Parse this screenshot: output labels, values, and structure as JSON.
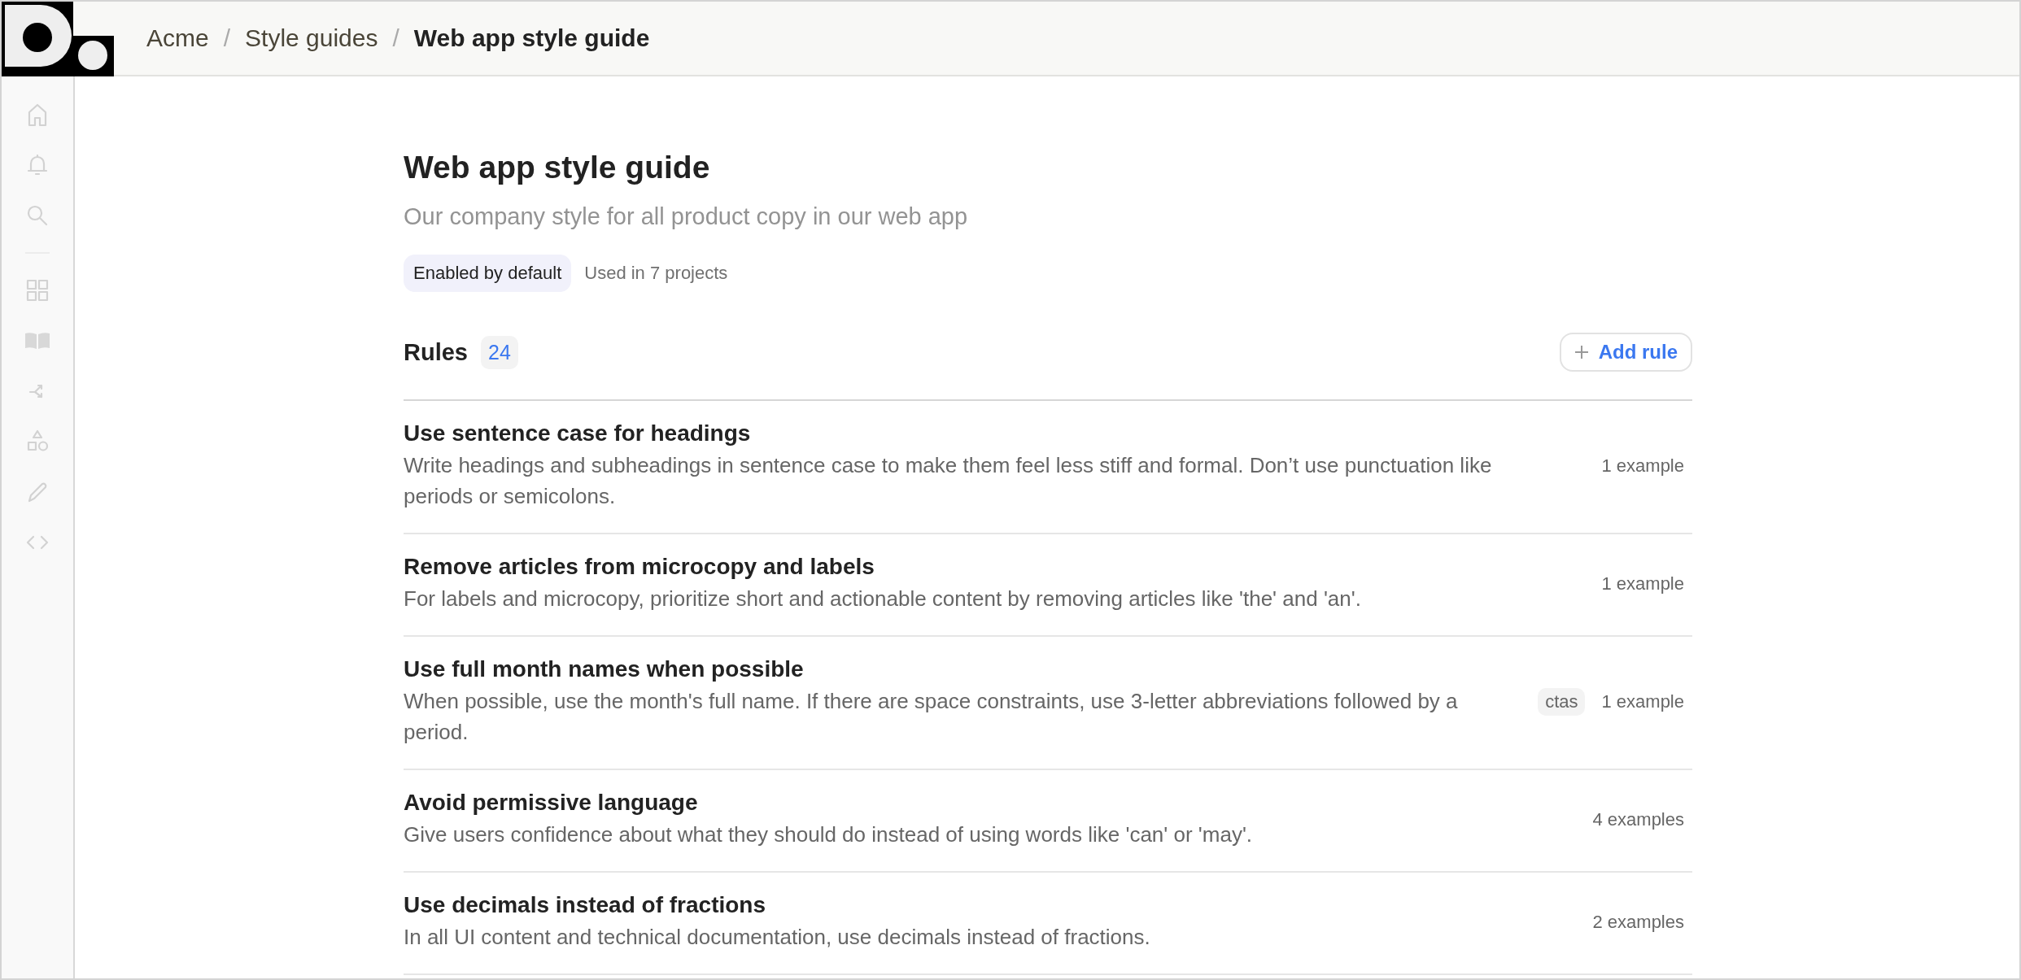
{
  "breadcrumbs": [
    {
      "label": "Acme",
      "current": false
    },
    {
      "label": "Style guides",
      "current": false
    },
    {
      "label": "Web app style guide",
      "current": true
    }
  ],
  "separator": "/",
  "sidebar": {
    "groups": [
      {
        "items": [
          {
            "kind": "home"
          },
          {
            "kind": "bell"
          },
          {
            "kind": "search"
          }
        ]
      },
      {
        "items": [
          {
            "kind": "grid"
          },
          {
            "kind": "book"
          },
          {
            "kind": "shuffle"
          },
          {
            "kind": "shapes"
          },
          {
            "kind": "pencil"
          },
          {
            "kind": "code"
          }
        ]
      }
    ]
  },
  "guide": {
    "title": "Web app style guide",
    "subtitle": "Our company style for all product copy in our web app",
    "badge": "Enabled by default",
    "usage": "Used in 7 projects"
  },
  "rules_header": {
    "title": "Rules",
    "count": "24",
    "add_button": "Add rule"
  },
  "rules": [
    {
      "title": "Use sentence case for headings",
      "description": "Write headings and subheadings in sentence case to make them feel less stiff and formal. Don’t use punctuation like periods or semicolons.",
      "examples": "1 example"
    },
    {
      "title": "Remove articles from microcopy and labels",
      "description": "For labels and microcopy, prioritize short and actionable content by removing articles like 'the' and 'an'.",
      "examples": "1 example"
    },
    {
      "title": "Use full month names when possible",
      "description": "When possible, use the month's full name. If there are space constraints, use 3-letter abbreviations followed by a period.",
      "tags": [
        "ctas"
      ],
      "examples": "1 example"
    },
    {
      "title": "Avoid permissive language",
      "description": "Give users confidence about what they should do instead of using words like 'can' or 'may'.",
      "examples": "4 examples"
    },
    {
      "title": "Use decimals instead of fractions",
      "description": "In all UI content and technical documentation, use decimals instead of fractions.",
      "examples": "2 examples"
    }
  ]
}
